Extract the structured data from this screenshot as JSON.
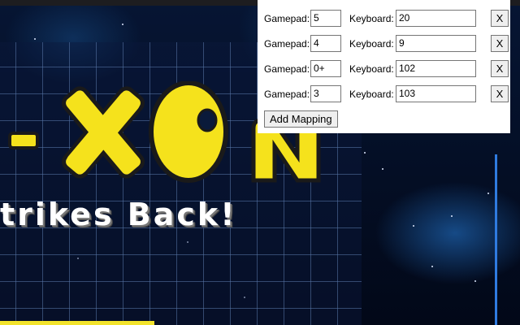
{
  "mappings": [
    {
      "gamepad_label": "Gamepad:",
      "gamepad_value": "5",
      "keyboard_label": "Keyboard:",
      "keyboard_value": "20",
      "remove_label": "X"
    },
    {
      "gamepad_label": "Gamepad:",
      "gamepad_value": "4",
      "keyboard_label": "Keyboard:",
      "keyboard_value": "9",
      "remove_label": "X"
    },
    {
      "gamepad_label": "Gamepad:",
      "gamepad_value": "0+",
      "keyboard_label": "Keyboard:",
      "keyboard_value": "102",
      "remove_label": "X"
    },
    {
      "gamepad_label": "Gamepad:",
      "gamepad_value": "3",
      "keyboard_label": "Keyboard:",
      "keyboard_value": "103",
      "remove_label": "X"
    }
  ],
  "add_button_label": "Add Mapping",
  "game": {
    "logo_text": "-XON",
    "tagline": "trikes Back!"
  },
  "colors": {
    "logo_yellow": "#f5e21c",
    "logo_outline": "#1a1a1a",
    "space_bg": "#040a1e",
    "grid_line": "#5a78aa",
    "edge_blue": "#2f7be0"
  }
}
